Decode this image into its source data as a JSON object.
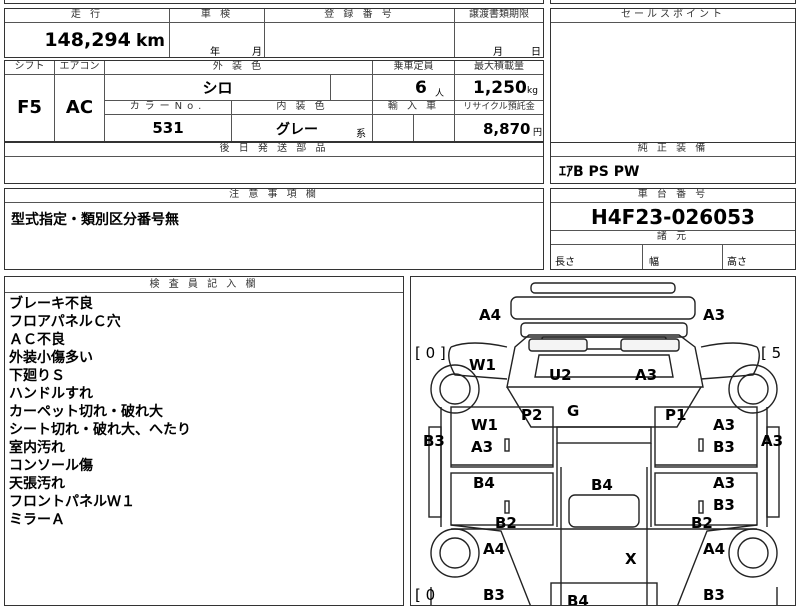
{
  "top": {
    "mileage_header": "走 行",
    "inspection_header": "車 検",
    "registration_header": "登 録 番 号",
    "transfer_header": "譲渡書類期限",
    "sales_point_header": "セールスポイント",
    "mileage_value": "148,294",
    "mileage_unit": "km",
    "inspection_year": "年",
    "inspection_month": "月",
    "transfer_month": "月",
    "transfer_day": "日"
  },
  "spec": {
    "shift_header": "シフト",
    "aircon_header": "エアコン",
    "exterior_color_header": "外 装 色",
    "capacity_header": "乗車定員",
    "max_load_header": "最大積載量",
    "shift_value": "F5",
    "aircon_value": "AC",
    "exterior_color_value": "シロ",
    "capacity_value": "6",
    "capacity_unit": "人",
    "max_load_value": "1,250",
    "max_load_unit": "kg",
    "color_no_header": "カラーNo.",
    "interior_color_header": "内 装 色",
    "import_header": "輸 入 車",
    "recycle_header": "リサイクル預託金",
    "color_no_value": "531",
    "interior_color_value": "グレー",
    "interior_color_suffix": "系",
    "recycle_value": "8,870",
    "recycle_unit": "円",
    "later_parts_header": "後 日 発 送 部 品"
  },
  "right": {
    "genuine_equipment_header": "純 正 装 備",
    "genuine_equipment_value": "ｴｱB PS PW",
    "chassis_header": "車 台 番 号",
    "chassis_value": "H4F23-026053",
    "dimensions_header": "諸 元",
    "length_label": "長さ",
    "width_label": "幅",
    "height_label": "高さ"
  },
  "caution": {
    "header": "注 意 事 項 欄",
    "value": "型式指定・類別区分番号無"
  },
  "inspector": {
    "header": "検 査 員 記 入 欄",
    "lines": [
      "ブレーキ不良",
      "フロアパネルＣ穴",
      "ＡＣ不良",
      "外装小傷多い",
      "下廻りＳ",
      "ハンドルすれ",
      "カーペット切れ・破れ大",
      "シート切れ・破れ大、へたり",
      "室内汚れ",
      "コンソール傷",
      "天張汚れ",
      "フロントパネルＷ１",
      "ミラーＡ"
    ]
  },
  "diagram": {
    "left_bracket": "[ 0 ]",
    "right_bracket": "[ 5",
    "left_bracket_bottom": "[ 0",
    "codes": {
      "a4_top_left": "A4",
      "a3_top_right": "A3",
      "w1_upper": "W1",
      "u2": "U2",
      "a3_windshield": "A3",
      "g": "G",
      "p2": "P2",
      "p1": "P1",
      "w1_lower": "W1",
      "a3_left_door": "A3",
      "b3_left": "B3",
      "a3_right_door1": "A3",
      "b3_right_door1": "B3",
      "a3_right_side": "A3",
      "b4_left": "B4",
      "b4_center": "B4",
      "a3_right_door2": "A3",
      "b3_right_door2": "B3",
      "b2_left": "B2",
      "b2_right": "B2",
      "a4_left_bottom": "A4",
      "x": "X",
      "a4_right_bottom": "A4",
      "b3_bottom_left": "B3",
      "b4_bottom_center": "B4",
      "b3_bottom_right": "B3"
    }
  }
}
